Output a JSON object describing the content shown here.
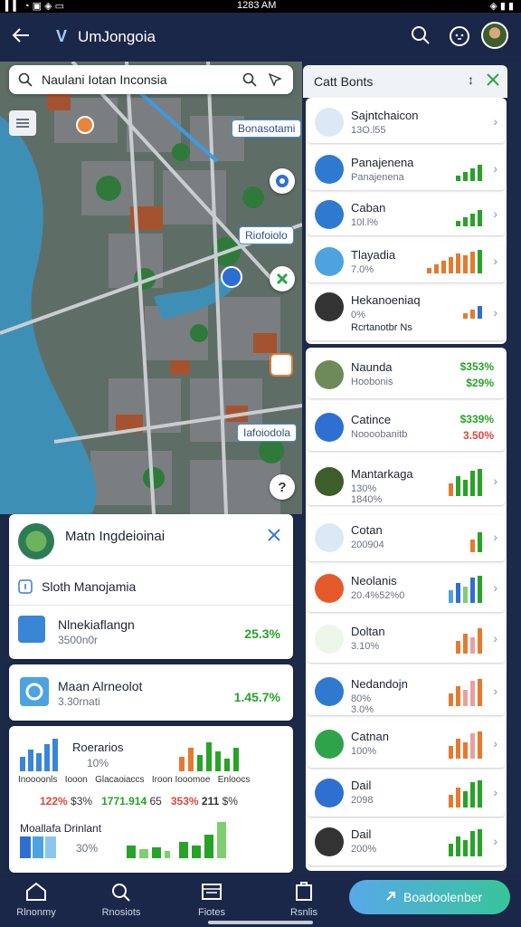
{
  "status": {
    "left": "▍▍ ◔ ▣ ◈ ▭",
    "time": "1283 AM",
    "right": "◈ ▮ ▮"
  },
  "header": {
    "title": "UmJongoia",
    "logo_mark": "V"
  },
  "search": {
    "value": "Naulani Iotan Inconsia"
  },
  "map_labels": {
    "l1": "Bonasotami",
    "l2": "Riofoiolo",
    "l3": "Iafoiodola"
  },
  "right_panel": {
    "title": "Catt Bonts",
    "items": [
      {
        "name": "Sajntchaicon",
        "sub": "13O.Ɩ55"
      },
      {
        "name": "Panajenena",
        "sub": "Panajenena"
      },
      {
        "name": "Caban",
        "sub": "10Ɩ.Ɩ%"
      },
      {
        "name": "Tlayadia",
        "sub": "7.0%"
      },
      {
        "name": "Hekanoeniaq",
        "sub": "0%",
        "sub2": "Rcrtanotbr Ns"
      }
    ],
    "items2": [
      {
        "name": "Naunda",
        "sub": "Hoobonis",
        "v1": "$353%",
        "v2": "$29%",
        "v2color": "#27a327"
      },
      {
        "name": "Catince",
        "sub": "Noooobanitb",
        "v1": "$339%",
        "v2": "3.50%",
        "v2color": "#e2443b"
      },
      {
        "name": "Mantarkaga",
        "sub": "130%",
        "sub2": "1840%"
      },
      {
        "name": "Cotan",
        "sub": "200904"
      },
      {
        "name": "Neolanis",
        "sub": "20.4%52%0"
      },
      {
        "name": "Doltan",
        "sub": "3.10%"
      },
      {
        "name": "Nedandojn",
        "sub": "80%",
        "sub2": "3.0%"
      },
      {
        "name": "Catnan",
        "sub": "100%"
      },
      {
        "name": "Dail",
        "sub": "2098"
      },
      {
        "name": "Dail",
        "sub": "200%"
      }
    ]
  },
  "left_panel": {
    "card_title": "Matn Ingdeioinai",
    "row1": "Sloth Manojamia",
    "row2_title": "Nlnekiaflangn",
    "row2_sub": "3500n0r",
    "row2_val": "25.3%",
    "row3_title": "Maan Alrneolot",
    "row3_sub": "3.30rnati",
    "row3_val": "1.45.7%",
    "stats_title": "Roerarios",
    "stats_pct": "10%",
    "stats_labels": [
      "Inoooonls",
      "Iooon",
      "Glacaoiaccs",
      "Iroon Iooomoe",
      "Enloocs"
    ],
    "stats_vals": [
      "122%",
      "$3%",
      "1771.914",
      "65",
      "353%",
      "211",
      "$%"
    ],
    "footer_title": "Moallafa Drinlant",
    "footer_pct": "30%"
  },
  "bottom_nav": [
    {
      "label": "Rlnonmy"
    },
    {
      "label": "Rnosiots"
    },
    {
      "label": "Fiotes"
    },
    {
      "label": "Rsnlis"
    }
  ],
  "cta": {
    "label": "Boadoolenber"
  }
}
